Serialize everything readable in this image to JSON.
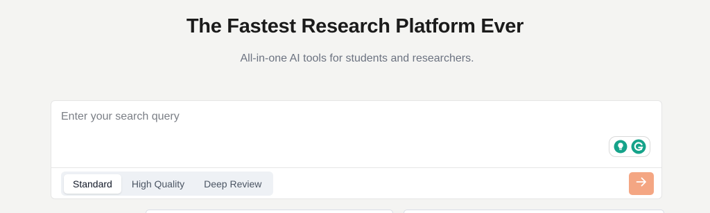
{
  "hero": {
    "title": "The Fastest Research Platform Ever",
    "subtitle": "All-in-one AI tools for students and researchers."
  },
  "search": {
    "placeholder": "Enter your search query",
    "value": ""
  },
  "modes": {
    "tabs": [
      {
        "label": "Standard",
        "active": true
      },
      {
        "label": "High Quality",
        "active": false
      },
      {
        "label": "Deep Review",
        "active": false
      }
    ]
  },
  "submit": {
    "icon": "arrow-right-icon",
    "color": "#f4a683"
  },
  "extensions": {
    "icons": [
      "lightbulb-icon",
      "grammarly-icon"
    ],
    "color": "#15a38a"
  }
}
